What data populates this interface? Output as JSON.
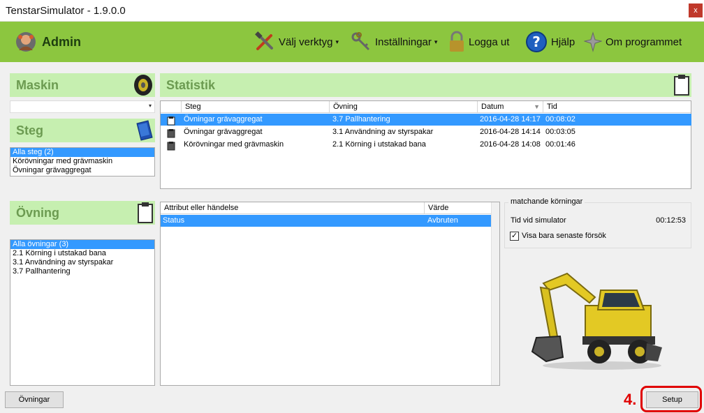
{
  "window": {
    "title": "TenstarSimulator - 1.9.0.0",
    "close_glyph": "x"
  },
  "topbar": {
    "user": "Admin",
    "menu": [
      {
        "label": "Välj verktyg",
        "has_caret": true
      },
      {
        "label": "Inställningar",
        "has_caret": true
      },
      {
        "label": "Logga ut"
      },
      {
        "label": "Hjälp"
      },
      {
        "label": "Om programmet"
      }
    ],
    "caret_glyph": "▾"
  },
  "maskin": {
    "title": "Maskin",
    "combo_value": "",
    "combo_arrow": "▾"
  },
  "steg": {
    "title": "Steg",
    "items": [
      "Alla steg (2)",
      "Körövningar med grävmaskin",
      "Övningar grävaggregat"
    ],
    "selected_index": 0
  },
  "ovning": {
    "title": "Övning",
    "items": [
      "Alla övningar (3)",
      "2.1 Körning i utstakad bana",
      "3.1 Användning av styrspakar",
      "3.7 Pallhantering"
    ],
    "selected_index": 0
  },
  "statistik": {
    "title": "Statistik",
    "columns": [
      "Steg",
      "Övning",
      "Datum",
      "Tid"
    ],
    "sort_glyph": "▼",
    "rows": [
      {
        "steg": "Övningar grävaggregat",
        "ovning": "3.7 Pallhantering",
        "datum": "2016-04-28 14:17",
        "tid": "00:08:02"
      },
      {
        "steg": "Övningar grävaggregat",
        "ovning": "3.1 Användning av styrspakar",
        "datum": "2016-04-28 14:14",
        "tid": "00:03:05"
      },
      {
        "steg": "Körövningar med grävmaskin",
        "ovning": "2.1 Körning i utstakad bana",
        "datum": "2016-04-28 14:08",
        "tid": "00:01:46"
      }
    ],
    "selected_index": 0
  },
  "attribut": {
    "columns": [
      "Attribut eller händelse",
      "Värde"
    ],
    "rows": [
      {
        "attr": "Status",
        "value": "Avbruten"
      }
    ]
  },
  "matchande": {
    "legend": "matchande körningar",
    "time_label": "Tid vid simulator",
    "time_value": "00:12:53",
    "checkbox_label": "Visa bara senaste försök",
    "checkbox_checked": true,
    "check_glyph": "✓"
  },
  "buttons": {
    "ovningar": "Övningar",
    "setup": "Setup"
  },
  "annotation": {
    "step_label": "4.",
    "color": "#e00000"
  },
  "colors": {
    "topbar": "#8cc63f",
    "section_header": "#c6efb0",
    "section_text": "#6c9b51",
    "selection": "#3399ff"
  }
}
